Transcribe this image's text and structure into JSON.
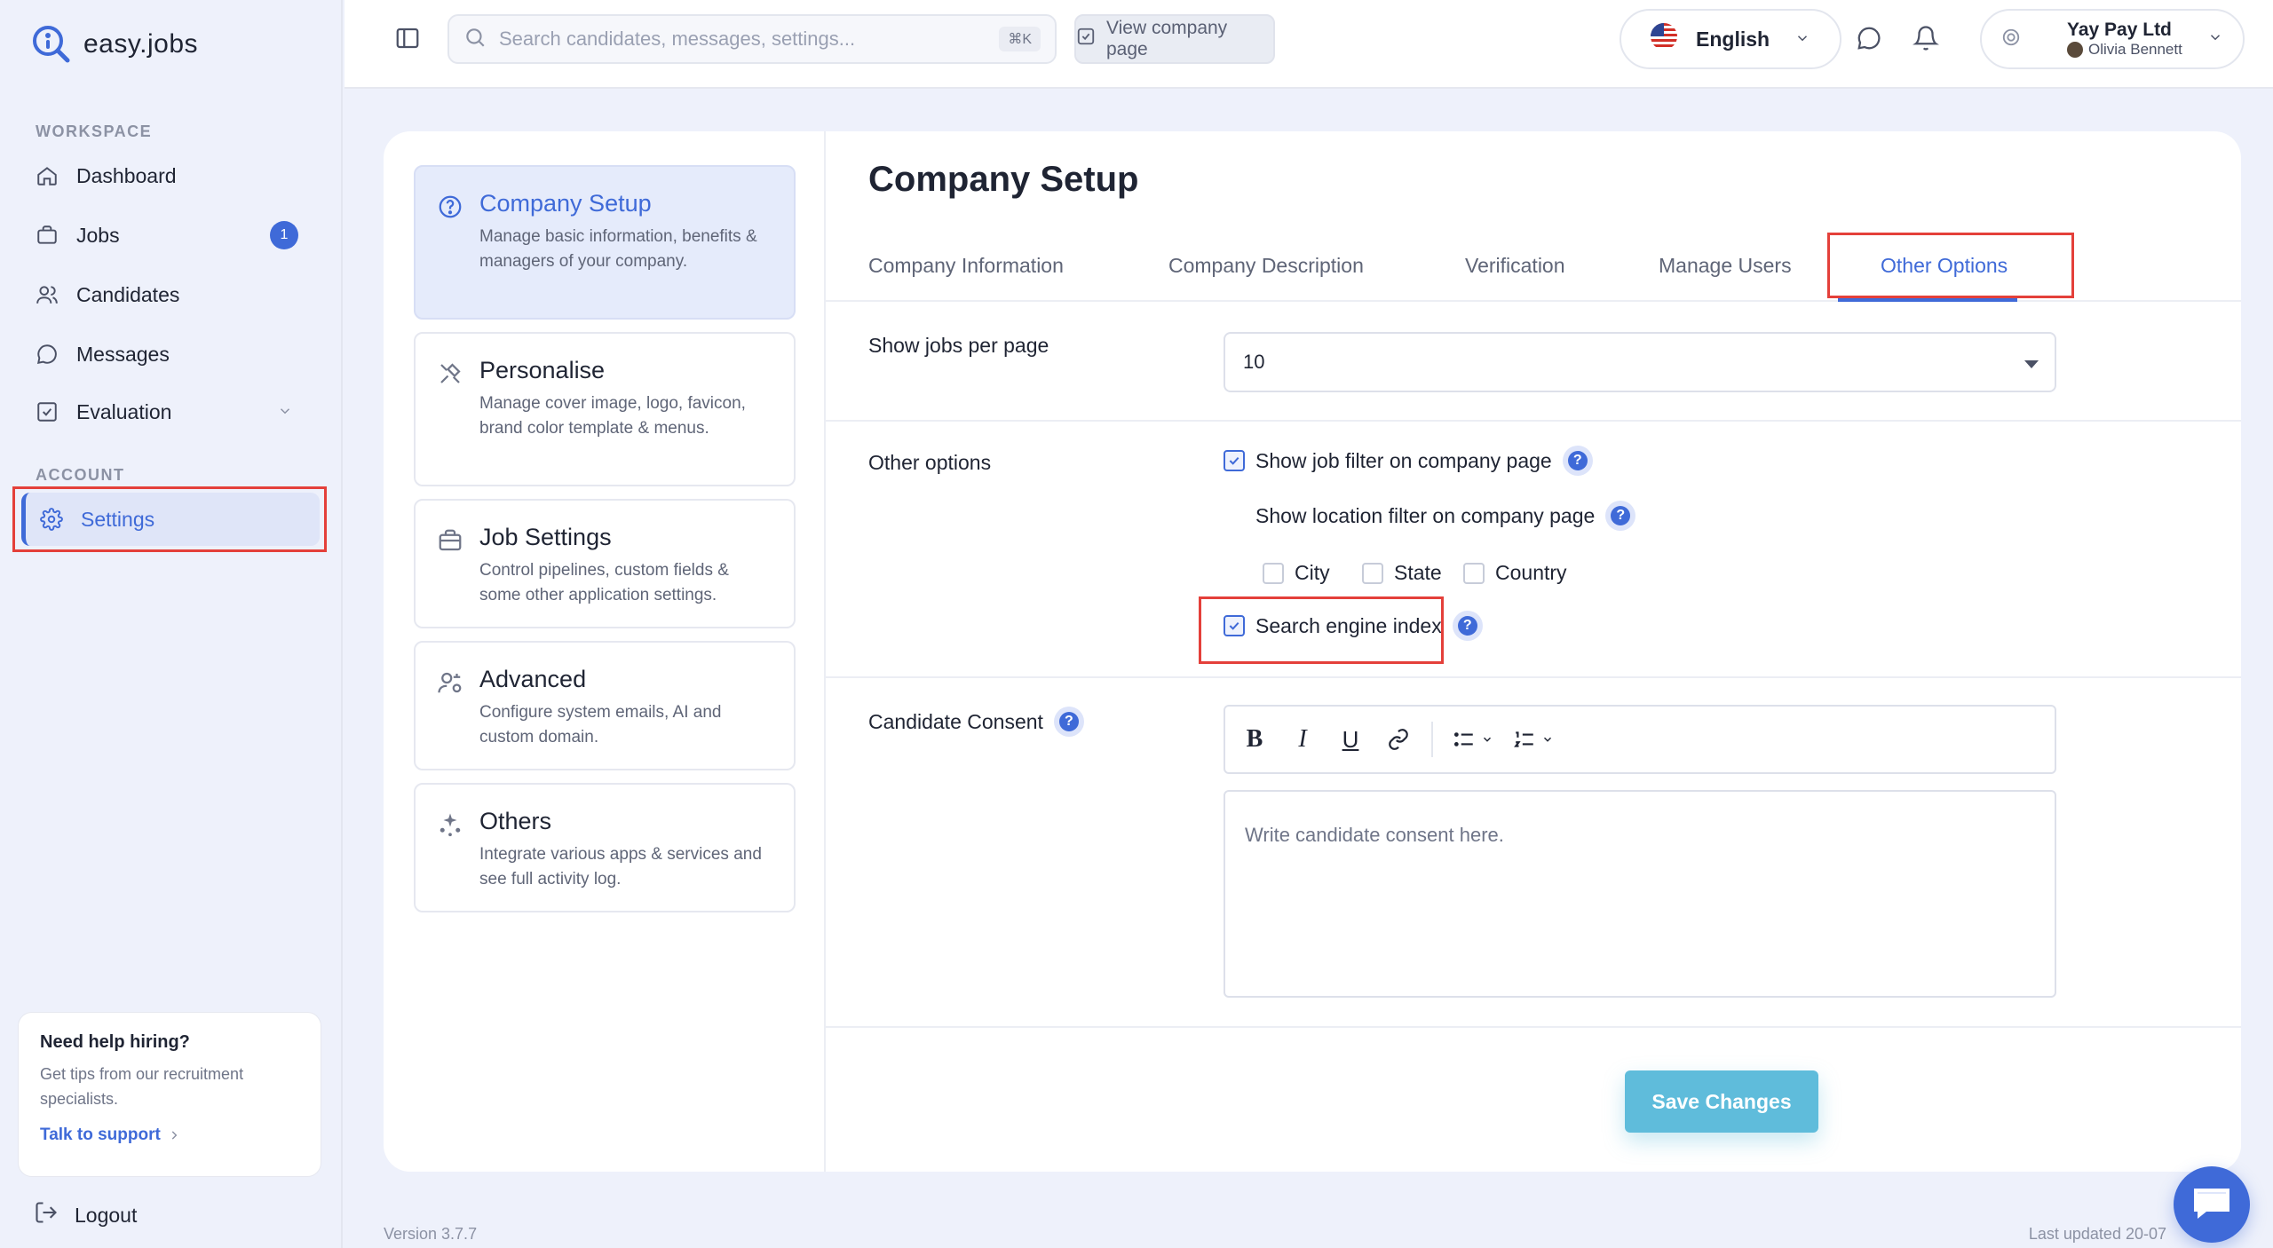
{
  "app": {
    "logo_text": "easy.jobs",
    "brand_color": "#3f6ad8"
  },
  "sidebar": {
    "workspace_label": "WORKSPACE",
    "account_label": "ACCOUNT",
    "items": [
      {
        "label": "Dashboard",
        "icon": "home-icon"
      },
      {
        "label": "Jobs",
        "icon": "briefcase-icon",
        "badge": "1"
      },
      {
        "label": "Candidates",
        "icon": "users-icon"
      },
      {
        "label": "Messages",
        "icon": "message-icon"
      },
      {
        "label": "Evaluation",
        "icon": "checklist-icon"
      },
      {
        "label": "Settings",
        "icon": "gear-icon",
        "active": true
      }
    ],
    "help": {
      "title": "Need help hiring?",
      "text": "Get tips from our recruitment specialists.",
      "link": "Talk to support"
    },
    "logout": "Logout"
  },
  "topbar": {
    "search_placeholder": "Search candidates, messages, settings...",
    "search_shortcut": "⌘K",
    "view_company": "View company page",
    "language": "English",
    "company_name": "Yay Pay Ltd",
    "user_name": "Olivia Bennett"
  },
  "settings_menu": [
    {
      "title": "Company Setup",
      "desc": "Manage basic information, benefits & managers of your company.",
      "active": true
    },
    {
      "title": "Personalise",
      "desc": "Manage cover image, logo, favicon, brand color template & menus."
    },
    {
      "title": "Job Settings",
      "desc": "Control pipelines, custom fields & some other application settings."
    },
    {
      "title": "Advanced",
      "desc": "Configure system emails, AI and custom domain."
    },
    {
      "title": "Others",
      "desc": "Integrate various apps & services and see full activity log."
    }
  ],
  "content": {
    "title": "Company Setup",
    "tabs": [
      "Company Information",
      "Company Description",
      "Verification",
      "Manage Users",
      "Other Options"
    ],
    "active_tab": "Other Options",
    "jobs_per_page_label": "Show jobs per page",
    "jobs_per_page_value": "10",
    "other_options_label": "Other options",
    "show_job_filter": "Show job filter on company page",
    "show_location_filter": "Show location filter on company page",
    "location_options": [
      "City",
      "State",
      "Country"
    ],
    "search_engine_index": "Search engine index",
    "candidate_consent_label": "Candidate Consent",
    "consent_placeholder": "Write candidate consent here.",
    "save_label": "Save Changes"
  },
  "footer": {
    "version": "Version 3.7.7",
    "last_updated": "Last updated 20-07"
  }
}
